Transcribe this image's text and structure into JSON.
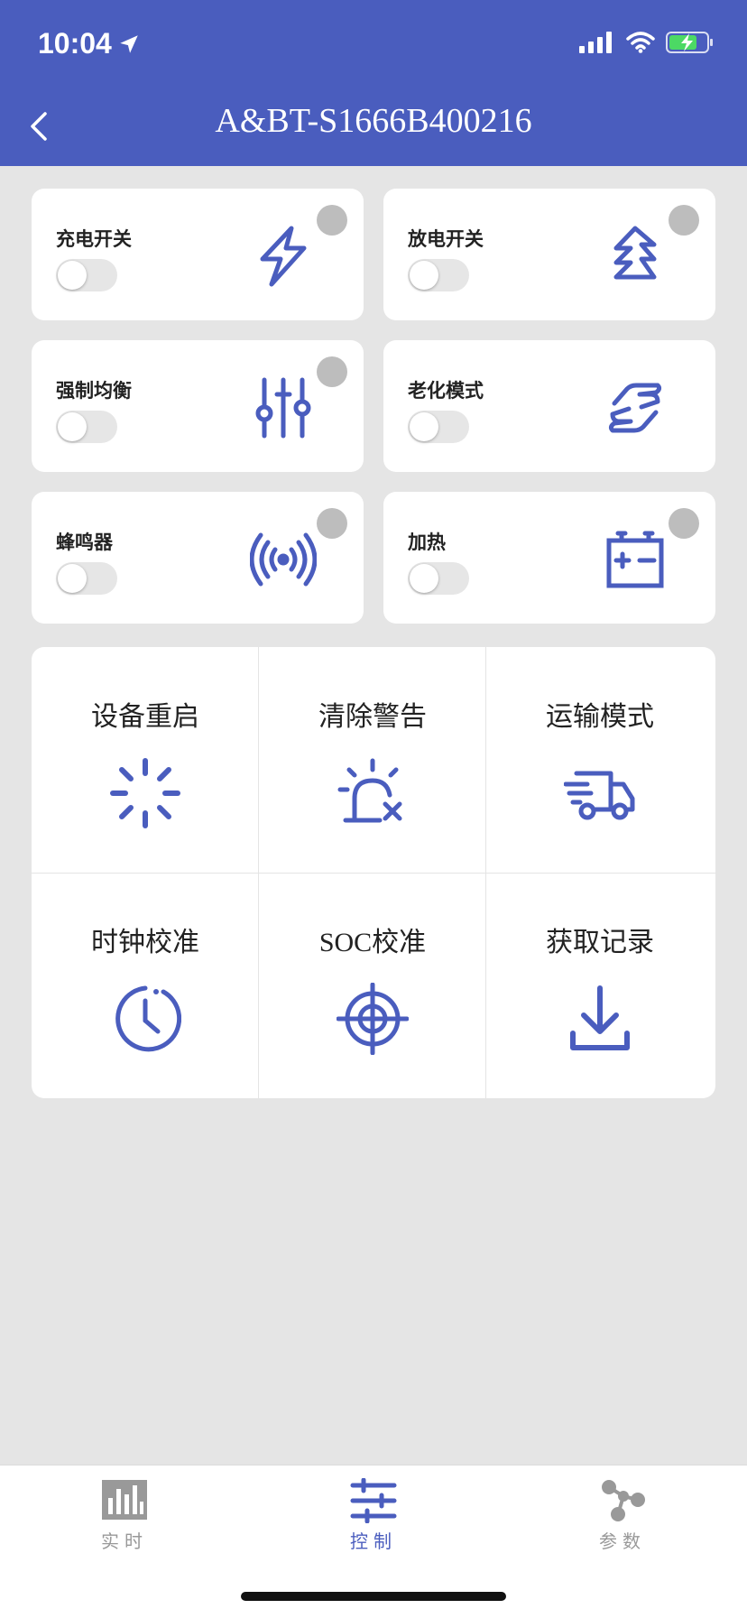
{
  "status_bar": {
    "time": "10:04"
  },
  "header": {
    "title": "A&BT-S1666B400216"
  },
  "toggles": [
    {
      "label": "充电开关",
      "icon": "lightning-icon"
    },
    {
      "label": "放电开关",
      "icon": "zigzag-arrows-icon"
    },
    {
      "label": "强制均衡",
      "icon": "sliders-icon"
    },
    {
      "label": "老化模式",
      "icon": "hand-cycle-icon"
    },
    {
      "label": "蜂鸣器",
      "icon": "signal-waves-icon"
    },
    {
      "label": "加热",
      "icon": "battery-icon"
    }
  ],
  "actions": [
    {
      "label": "设备重启",
      "icon": "loading-spinner-icon"
    },
    {
      "label": "清除警告",
      "icon": "alarm-clear-icon"
    },
    {
      "label": "运输模式",
      "icon": "truck-icon"
    },
    {
      "label": "时钟校准",
      "icon": "clock-icon"
    },
    {
      "label": "SOC校准",
      "icon": "crosshair-icon"
    },
    {
      "label": "获取记录",
      "icon": "download-icon"
    }
  ],
  "tabs": [
    {
      "label": "实时",
      "icon": "bar-graph-icon",
      "active": false
    },
    {
      "label": "控制",
      "icon": "control-sliders-icon",
      "active": true
    },
    {
      "label": "参数",
      "icon": "network-nodes-icon",
      "active": false
    }
  ],
  "colors": {
    "primary": "#4a5dbe",
    "inactive": "#999999",
    "background": "#e5e5e5"
  }
}
